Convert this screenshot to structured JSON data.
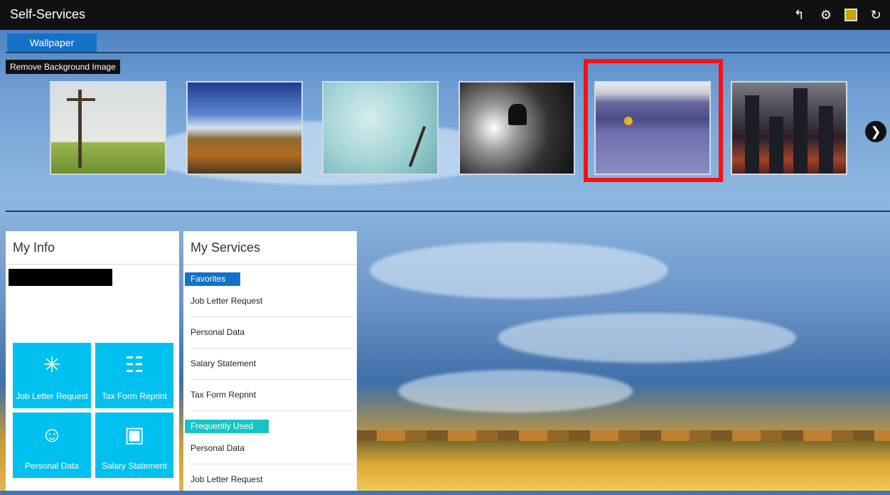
{
  "app": {
    "title": "Self-Services"
  },
  "toolbar": {
    "icons": [
      "back-icon",
      "settings-icon",
      "image-icon",
      "refresh-icon"
    ]
  },
  "wallpaper": {
    "tab_label": "Wallpaper",
    "remove_tooltip": "Remove Background Image",
    "thumbnails": [
      "signpost",
      "sky-road",
      "dandelion",
      "snowboarder",
      "lavender-field",
      "city-night"
    ],
    "selected_index": 4,
    "next_icon": "chevron-right-icon"
  },
  "my_info": {
    "title": "My Info",
    "tiles": [
      {
        "label": "Job Letter Request",
        "icon": "palm-icon"
      },
      {
        "label": "Tax Form Reprint",
        "icon": "org-chart-icon"
      },
      {
        "label": "Personal Data",
        "icon": "person-board-icon"
      },
      {
        "label": "Salary Statement",
        "icon": "money-icon"
      }
    ]
  },
  "my_services": {
    "title": "My Services",
    "favorites_label": "Favorites",
    "favorites": [
      "Job Letter Request",
      "Personal Data",
      "Salary Statement",
      "Tax Form Reprint"
    ],
    "frequent_label": "Frequently Used",
    "frequent": [
      "Personal Data",
      "Job Letter Request"
    ]
  }
}
